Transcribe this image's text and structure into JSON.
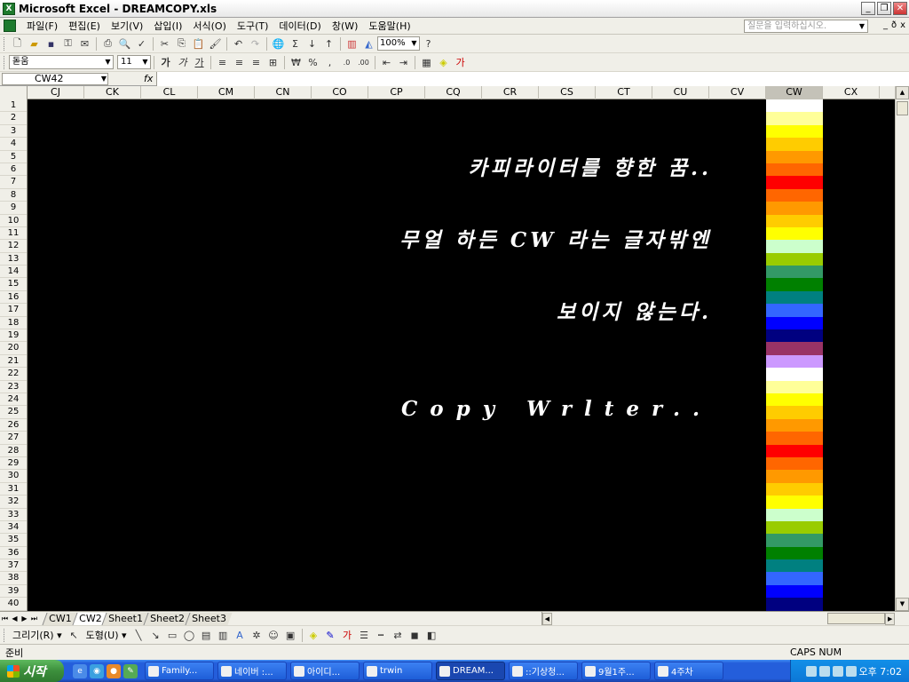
{
  "window": {
    "title": "Microsoft Excel - DREAMCOPY.xls",
    "btn_min": "_",
    "btn_restore": "❐",
    "btn_close": "✕"
  },
  "menu": {
    "items": [
      "파일(F)",
      "편집(E)",
      "보기(V)",
      "삽입(I)",
      "서식(O)",
      "도구(T)",
      "데이터(D)",
      "창(W)",
      "도움말(H)"
    ],
    "ask_placeholder": "질문을 입력하십시오.",
    "mdi_min": "_",
    "mdi_restore": "ð",
    "mdi_close": "x"
  },
  "toolbar": {
    "zoom": "100%",
    "font_name": "돋움",
    "font_size": "11"
  },
  "formula": {
    "name_box": "CW42",
    "fx": "fx",
    "value": ""
  },
  "columns": [
    "CJ",
    "CK",
    "CL",
    "CM",
    "CN",
    "CO",
    "CP",
    "CQ",
    "CR",
    "CS",
    "CT",
    "CU",
    "CV",
    "CW",
    "CX"
  ],
  "selected_column": "CW",
  "rows": [
    "1",
    "2",
    "3",
    "4",
    "5",
    "6",
    "7",
    "8",
    "9",
    "10",
    "11",
    "12",
    "13",
    "14",
    "15",
    "16",
    "17",
    "18",
    "19",
    "20",
    "21",
    "22",
    "23",
    "24",
    "25",
    "26",
    "27",
    "28",
    "29",
    "30",
    "31",
    "32",
    "33",
    "34",
    "35",
    "36",
    "37",
    "38",
    "39",
    "40"
  ],
  "sheet": {
    "background": "#000000",
    "text_color": "#ffffff",
    "line1": "카피라이터를 향한 꿈..",
    "line2": "무얼 하든 CW 라는 글자밖엔",
    "line3": "보이지 않는다.",
    "line4": "Copy Wrlter..",
    "column_colors": [
      "#ffffff",
      "#ffff99",
      "#ffff00",
      "#ffcc00",
      "#ff9900",
      "#ff6600",
      "#ff0000",
      "#ff6600",
      "#ff9900",
      "#ffcc00",
      "#ffff00",
      "#ccffcc",
      "#99cc00",
      "#339966",
      "#008000",
      "#008080",
      "#3366ff",
      "#0000ff",
      "#000080",
      "#993366",
      "#cc99ff",
      "#ffffff",
      "#ffff99",
      "#ffff00",
      "#ffcc00",
      "#ff9900",
      "#ff6600",
      "#ff0000",
      "#ff6600",
      "#ff9900",
      "#ffcc00",
      "#ffff00",
      "#ccffcc",
      "#99cc00",
      "#339966",
      "#008000",
      "#008080",
      "#3366ff",
      "#0000ff",
      "#000080"
    ]
  },
  "tabs": {
    "nav": [
      "⏮",
      "◀",
      "▶",
      "⏭"
    ],
    "sheets": [
      "CW1",
      "CW2",
      "Sheet1",
      "Sheet2",
      "Sheet3"
    ],
    "active": "CW2"
  },
  "drawbar": {
    "draw": "그리기(R) ▾",
    "shapes": "도형(U) ▾"
  },
  "status": {
    "ready": "준비",
    "indicators": "CAPS NUM"
  },
  "taskbar": {
    "start": "시작",
    "tasks": [
      "Family...",
      "네이버 :...",
      "아이디...",
      "trwin",
      "DREAM...",
      "::기상청...",
      "9월1주...",
      "4주차"
    ],
    "active_task": "DREAM...",
    "clock": "오후 7:02"
  }
}
